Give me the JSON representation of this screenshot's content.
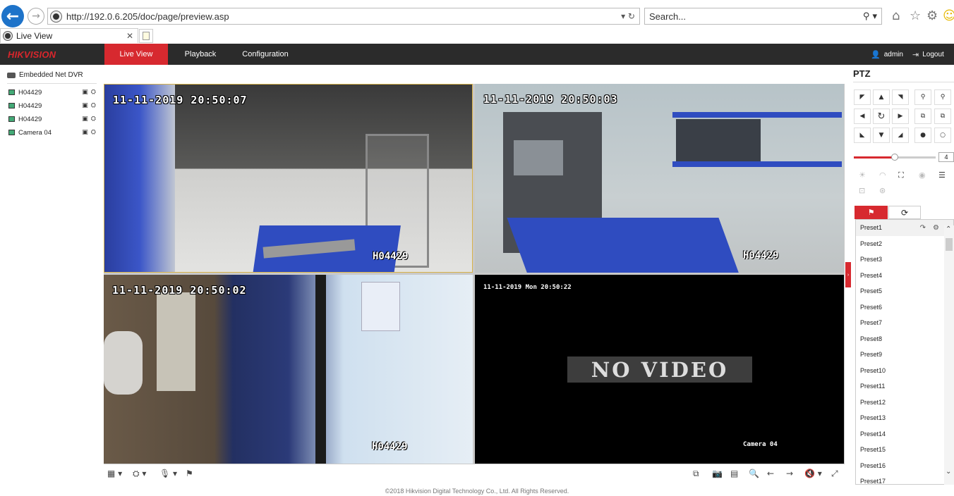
{
  "browser": {
    "url": "http://192.0.6.205/doc/page/preview.asp",
    "search_placeholder": "Search...",
    "tab_title": "Live View",
    "icons": [
      "back-icon",
      "forward-icon",
      "home-icon",
      "star-icon",
      "gear-icon",
      "smiley-icon"
    ]
  },
  "header": {
    "logo": "HIKVISION",
    "menu": [
      {
        "label": "Live View",
        "active": true
      },
      {
        "label": "Playback"
      },
      {
        "label": "Configuration"
      }
    ],
    "user": "admin",
    "logout": "Logout",
    "accent_color": "#d7292f"
  },
  "tree": {
    "root": "Embedded Net DVR",
    "cameras": [
      "H04429",
      "H04429",
      "H04429",
      "Camera 04"
    ]
  },
  "video": {
    "tiles": [
      {
        "timestamp": "11-11-2019 20:50:07",
        "name": "H04429"
      },
      {
        "timestamp": "11-11-2019 20:50:03",
        "name": "H04429"
      },
      {
        "timestamp": "11-11-2019 20:50:02",
        "name": "H04429"
      },
      {
        "timestamp": "11-11-2019 Mon 20:50:22",
        "name": "Camera 04",
        "status": "NO VIDEO"
      }
    ]
  },
  "ptz": {
    "title": "PTZ",
    "speed": "4",
    "speed_level": 0.4,
    "presets": [
      "Preset1",
      "Preset2",
      "Preset3",
      "Preset4",
      "Preset5",
      "Preset6",
      "Preset7",
      "Preset8",
      "Preset9",
      "Preset10",
      "Preset11",
      "Preset12",
      "Preset13",
      "Preset14",
      "Preset15",
      "Preset16",
      "Preset17"
    ]
  },
  "footer": "©2018 Hikvision Digital Technology Co., Ltd. All Rights Reserved."
}
